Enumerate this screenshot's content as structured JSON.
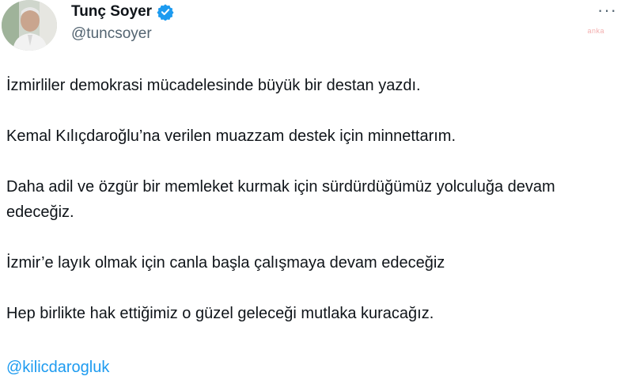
{
  "author": {
    "display_name": "Tunç Soyer",
    "handle": "@tuncsoyer",
    "verified": true
  },
  "icons": {
    "avatar": "profile-photo",
    "verified": "verified-badge-icon",
    "more": "more-options-icon"
  },
  "more_label": "···",
  "watermark": "anka",
  "paragraphs": [
    "İzmirliler demokrasi mücadelesinde büyük bir destan yazdı.",
    "Kemal Kılıçdaroğlu’na verilen muazzam destek için minnettarım.",
    "Daha adil ve özgür bir memleket kurmak için sürdürdüğümüz yolculuğa devam edeceğiz.",
    "İzmir’e layık olmak için canla başla çalışmaya devam edeceğiz",
    "Hep birlikte hak ettiğimiz o güzel geleceği mutlaka kuracağız."
  ],
  "mention": "@kilicdarogluk",
  "colors": {
    "text": "#0f1419",
    "secondary": "#536471",
    "link": "#1d9bf0",
    "verified": "#1d9bf0"
  }
}
